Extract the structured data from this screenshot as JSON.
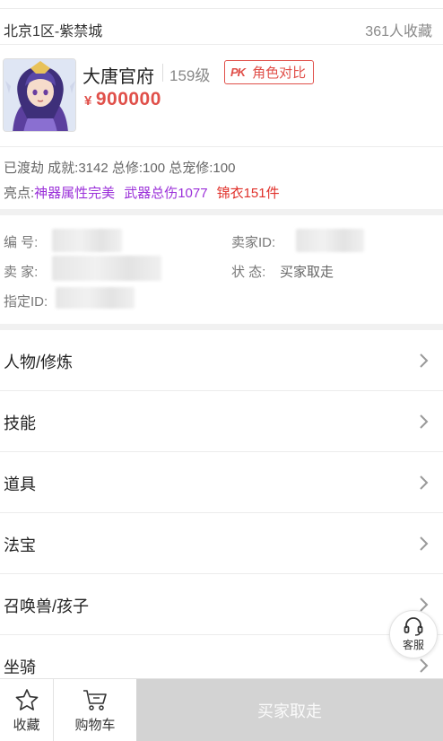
{
  "header": {
    "server": "北京1区-紫禁城",
    "favorites_count": "361人收藏"
  },
  "role": {
    "name": "大唐官府",
    "level": "159级",
    "compare_icon": "PK",
    "compare_label": "角色对比",
    "price_symbol": "¥",
    "price": "900000"
  },
  "summary": {
    "stats": "已渡劫 成就:3142 总修:100 总宠修:100",
    "highlights_label": "亮点:",
    "highlights": [
      {
        "text": "神器属性完美",
        "color": "#9b30d9"
      },
      {
        "text": "武器总伤1077",
        "color": "#9b30d9"
      },
      {
        "text": "锦衣151件",
        "color": "#e0302a"
      }
    ]
  },
  "info": {
    "serial_label": "编 号:",
    "seller_id_label": "卖家ID:",
    "seller_label": "卖 家:",
    "status_label": "状 态:",
    "status_value": "买家取走",
    "assigned_id_label": "指定ID:"
  },
  "menu": [
    {
      "label": "人物/修炼"
    },
    {
      "label": "技能"
    },
    {
      "label": "道具"
    },
    {
      "label": "法宝"
    },
    {
      "label": "召唤兽/孩子"
    },
    {
      "label": "坐骑"
    }
  ],
  "customer_service": {
    "label": "客服",
    "icon": "headset-icon"
  },
  "bottom_bar": {
    "favorite_label": "收藏",
    "favorite_icon": "star-icon",
    "cart_label": "购物车",
    "cart_icon": "cart-icon",
    "buy_label": "买家取走"
  },
  "colors": {
    "accent_red": "#e0504a",
    "purple": "#9b30d9",
    "disabled_button": "#d3d3d3"
  }
}
